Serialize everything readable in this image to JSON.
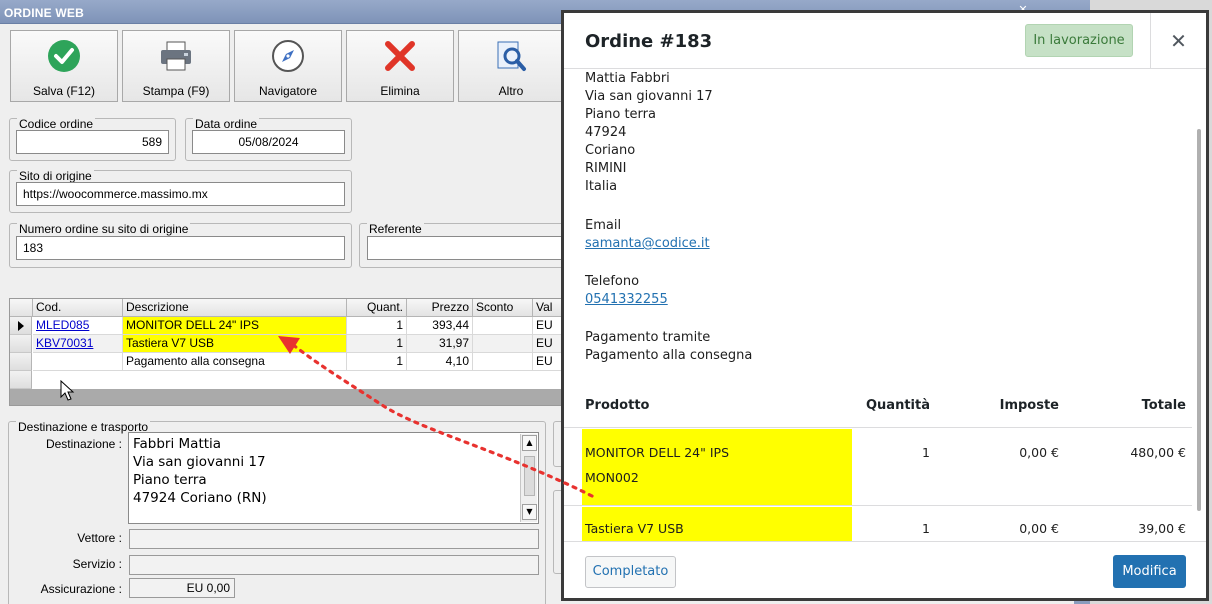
{
  "window": {
    "title": "ORDINE WEB",
    "close_glyph": "✕"
  },
  "toolbar": [
    {
      "label": "Salva (F12)",
      "icon": "check-circle-icon"
    },
    {
      "label": "Stampa (F9)",
      "icon": "printer-icon"
    },
    {
      "label": "Navigatore",
      "icon": "compass-icon"
    },
    {
      "label": "Elimina",
      "icon": "red-x-icon"
    },
    {
      "label": "Altro",
      "icon": "magnifier-icon"
    }
  ],
  "form": {
    "codice_ordine_label": "Codice ordine",
    "codice_ordine": "589",
    "data_ordine_label": "Data ordine",
    "data_ordine": "05/08/2024",
    "sito_label": "Sito di origine",
    "sito": "https://woocommerce.massimo.mx",
    "numero_label": "Numero ordine su sito di origine",
    "numero": "183",
    "referente_label": "Referente",
    "referente": ""
  },
  "grid": {
    "headers": [
      "Cod.",
      "Descrizione",
      "Quant.",
      "Prezzo",
      "Sconto",
      "Val"
    ],
    "rows": [
      {
        "cod": "MLED085",
        "descr": "MONITOR DELL 24\" IPS",
        "qty": "1",
        "prezzo": "393,44",
        "sconto": "",
        "val": "EU"
      },
      {
        "cod": "KBV70031",
        "descr": "Tastiera V7 USB",
        "qty": "1",
        "prezzo": "31,97",
        "sconto": "",
        "val": "EU"
      },
      {
        "cod": "",
        "descr": "Pagamento alla consegna",
        "qty": "1",
        "prezzo": "4,10",
        "sconto": "",
        "val": "EU"
      }
    ]
  },
  "destinazione": {
    "group_label": "Destinazione e trasporto",
    "dest_label": "Destinazione :",
    "lines": [
      "Fabbri Mattia",
      "Via san giovanni 17",
      "Piano terra",
      "47924 Coriano (RN)"
    ],
    "vettore_label": "Vettore :",
    "servizio_label": "Servizio :",
    "assicurazione_label": "Assicurazione :",
    "assicurazione": "EU 0,00"
  },
  "modal": {
    "title": "Ordine #183",
    "status": "In lavorazione",
    "close": "✕",
    "address": [
      "Mattia Fabbri",
      "Via san giovanni 17",
      "Piano terra",
      "47924",
      "Coriano",
      "RIMINI",
      "Italia"
    ],
    "email_label": "Email",
    "email": "samanta@codice.it",
    "phone_label": "Telefono",
    "phone": "0541332255",
    "payment_label": "Pagamento tramite",
    "payment": "Pagamento alla consegna",
    "table_headers": {
      "product": "Prodotto",
      "qty": "Quantità",
      "tax": "Imposte",
      "total": "Totale"
    },
    "items": [
      {
        "name": "MONITOR DELL 24\" IPS",
        "sku": "MON002",
        "qty": "1",
        "tax": "0,00 €",
        "total": "480,00 €"
      },
      {
        "name": "Tastiera V7 USB",
        "sku": "",
        "qty": "1",
        "tax": "0,00 €",
        "total": "39,00 €"
      }
    ],
    "btn_completed": "Completato",
    "btn_edit": "Modifica"
  },
  "colors": {
    "highlight": "#ffff00",
    "primary": "#2271b1",
    "status_bg": "#c6e1c6",
    "arrow": "#e8322f"
  }
}
